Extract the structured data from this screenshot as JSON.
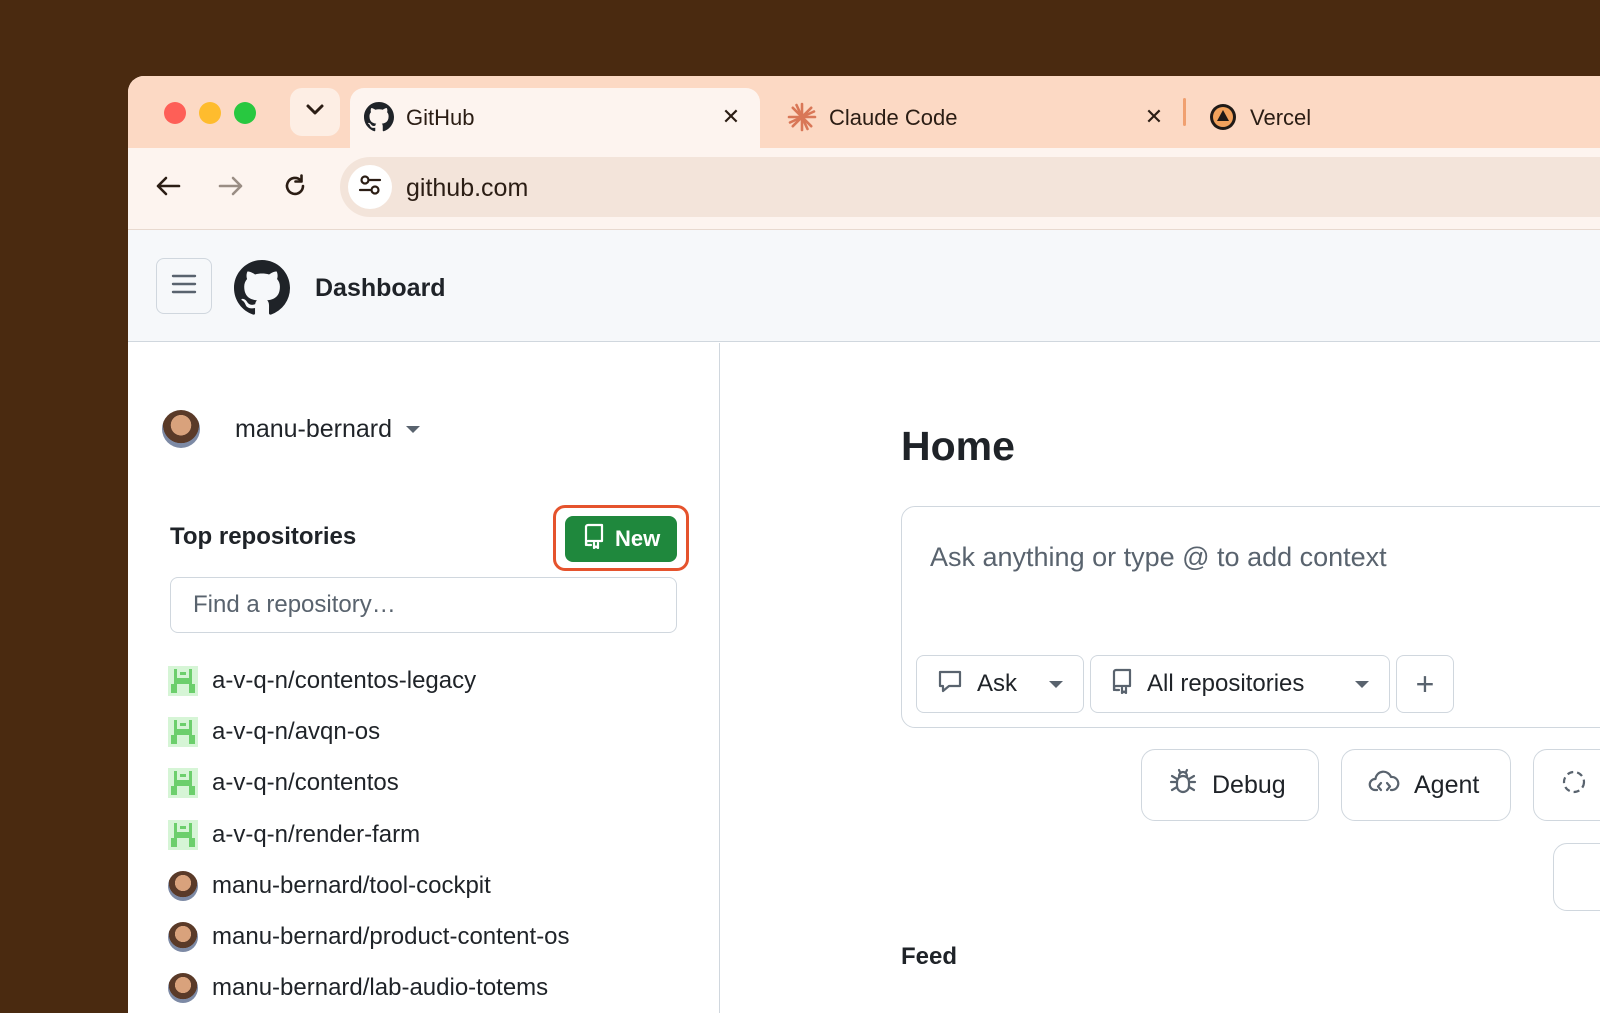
{
  "browser": {
    "tabs": [
      {
        "title": "GitHub",
        "icon": "github-icon",
        "active": true
      },
      {
        "title": "Claude Code",
        "icon": "claude-icon",
        "active": false
      },
      {
        "title": "Vercel",
        "icon": "vercel-icon",
        "active": false
      }
    ],
    "close_glyph": "✕",
    "url": "github.com"
  },
  "header": {
    "context": "Dashboard"
  },
  "sidebar": {
    "user": "manu-bernard",
    "top_repos_title": "Top repositories",
    "new_button": "New",
    "search_placeholder": "Find a repository…",
    "repos": [
      {
        "name": "a-v-q-n/contentos-legacy",
        "icon": "org-invader-icon"
      },
      {
        "name": "a-v-q-n/avqn-os",
        "icon": "org-invader-icon"
      },
      {
        "name": "a-v-q-n/contentos",
        "icon": "org-invader-icon"
      },
      {
        "name": "a-v-q-n/render-farm",
        "icon": "org-invader-icon"
      },
      {
        "name": "manu-bernard/tool-cockpit",
        "icon": "user-avatar"
      },
      {
        "name": "manu-bernard/product-content-os",
        "icon": "user-avatar"
      },
      {
        "name": "manu-bernard/lab-audio-totems",
        "icon": "user-avatar"
      }
    ]
  },
  "main": {
    "title": "Home",
    "copilot": {
      "placeholder": "Ask anything or type @ to add context",
      "mode": "Ask",
      "scope": "All repositories",
      "add": "+"
    },
    "quick_actions": [
      "Debug",
      "Agent"
    ],
    "feed_title": "Feed"
  },
  "colors": {
    "tabbar": "#fcd9c4",
    "primary_button": "#1f883d",
    "highlight": "#e5532d"
  }
}
